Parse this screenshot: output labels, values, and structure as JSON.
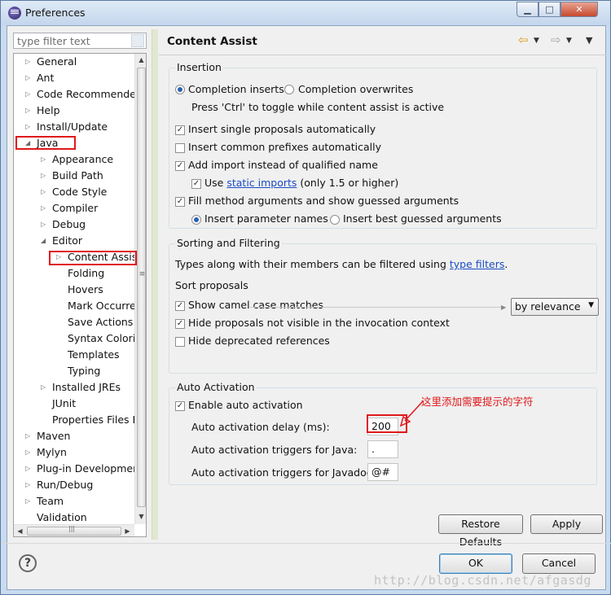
{
  "window": {
    "title": "Preferences",
    "minimize": "▁",
    "maximize": "□",
    "close": "✕"
  },
  "filter": {
    "placeholder": "type filter text"
  },
  "tree": {
    "items": [
      {
        "label": "General",
        "twisty": "▷"
      },
      {
        "label": "Ant",
        "twisty": "▷"
      },
      {
        "label": "Code Recommenders",
        "twisty": "▷"
      },
      {
        "label": "Help",
        "twisty": "▷"
      },
      {
        "label": "Install/Update",
        "twisty": "▷"
      },
      {
        "label": "Java",
        "twisty": "◢"
      },
      {
        "label": "Appearance",
        "twisty": "▷"
      },
      {
        "label": "Build Path",
        "twisty": "▷"
      },
      {
        "label": "Code Style",
        "twisty": "▷"
      },
      {
        "label": "Compiler",
        "twisty": "▷"
      },
      {
        "label": "Debug",
        "twisty": "▷"
      },
      {
        "label": "Editor",
        "twisty": "◢"
      },
      {
        "label": "Content Assist",
        "twisty": "▷"
      },
      {
        "label": "Folding",
        "twisty": ""
      },
      {
        "label": "Hovers",
        "twisty": ""
      },
      {
        "label": "Mark Occurrences",
        "twisty": ""
      },
      {
        "label": "Save Actions",
        "twisty": ""
      },
      {
        "label": "Syntax Coloring",
        "twisty": ""
      },
      {
        "label": "Templates",
        "twisty": ""
      },
      {
        "label": "Typing",
        "twisty": ""
      },
      {
        "label": "Installed JREs",
        "twisty": "▷"
      },
      {
        "label": "JUnit",
        "twisty": ""
      },
      {
        "label": "Properties Files Editor",
        "twisty": ""
      },
      {
        "label": "Maven",
        "twisty": "▷"
      },
      {
        "label": "Mylyn",
        "twisty": "▷"
      },
      {
        "label": "Plug-in Development",
        "twisty": "▷"
      },
      {
        "label": "Run/Debug",
        "twisty": "▷"
      },
      {
        "label": "Team",
        "twisty": "▷"
      },
      {
        "label": "Validation",
        "twisty": ""
      }
    ]
  },
  "page": {
    "title": "Content Assist",
    "back": "⇦",
    "forward": "⇨",
    "dropdown": "▼"
  },
  "insertion": {
    "title": "Insertion",
    "completion_inserts": "Completion inserts",
    "completion_overwrites": "Completion overwrites",
    "toggle_hint": "Press 'Ctrl' to toggle while content assist is active",
    "insert_single": "Insert single proposals automatically",
    "insert_common": "Insert common prefixes automatically",
    "add_import": "Add import instead of qualified name",
    "use": "Use",
    "static_imports": "static imports",
    "only_15": "(only 1.5 or higher)",
    "fill_args": "Fill method arguments and show guessed arguments",
    "insert_param": "Insert parameter names",
    "insert_best": "Insert best guessed arguments",
    "check": "✓"
  },
  "sorting": {
    "title": "Sorting and Filtering",
    "types_text": "Types along with their members can be filtered using",
    "type_filters": "type filters",
    "period": ".",
    "sort_proposals": "Sort proposals",
    "sort_value": "by relevance",
    "show_camel": "Show camel case matches",
    "hide_not_visible": "Hide proposals not visible in the invocation context",
    "hide_deprecated": "Hide deprecated references"
  },
  "auto": {
    "title": "Auto Activation",
    "enable": "Enable auto activation",
    "delay_label": "Auto activation delay (ms):",
    "delay_value": "200",
    "java_label": "Auto activation triggers for Java:",
    "java_value": ".",
    "javadoc_label": "Auto activation triggers for Javadoc:",
    "javadoc_value": "@#"
  },
  "annotation": "这里添加需要提示的字符",
  "buttons": {
    "restore": "Restore Defaults",
    "apply": "Apply",
    "ok": "OK",
    "cancel": "Cancel",
    "help": "?"
  },
  "scroll": {
    "up": "▲",
    "down": "▼",
    "left": "◀",
    "right": "▶",
    "grip": "≡",
    "hgrip": "|||"
  },
  "watermark": "http://blog.csdn.net/afgasdg"
}
